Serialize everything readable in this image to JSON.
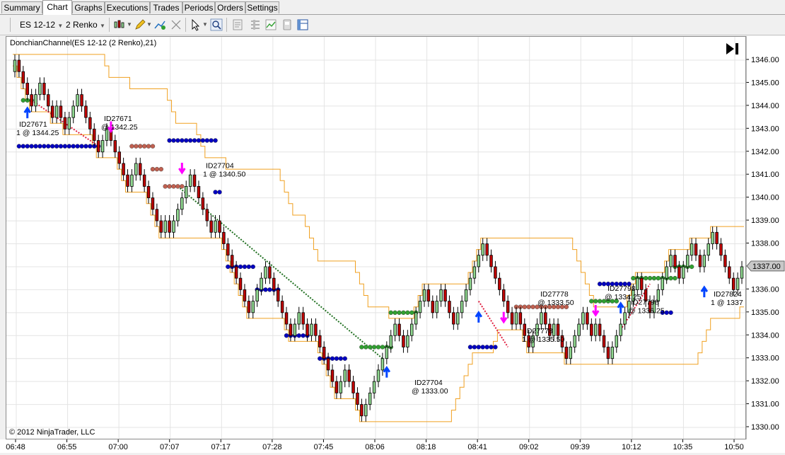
{
  "tabs": [
    {
      "label": "Summary",
      "active": false
    },
    {
      "label": "Chart",
      "active": true
    },
    {
      "label": "Graphs",
      "active": false
    },
    {
      "label": "Executions",
      "active": false
    },
    {
      "label": "Trades",
      "active": false
    },
    {
      "label": "Periods",
      "active": false
    },
    {
      "label": "Orders",
      "active": false
    },
    {
      "label": "Settings",
      "active": false
    }
  ],
  "toolbar": {
    "instrument": "ES 12-12",
    "bar_type": "2 Renko",
    "icons": [
      "bar-style-icon",
      "drawing-pencil-icon",
      "add-indicator-icon",
      "cursor-icon",
      "zoom-icon",
      "properties-icon",
      "data-box-icon",
      "strategy-icon",
      "chart-template-icon",
      "window-split-icon"
    ]
  },
  "chart": {
    "indicator_label": "DonchianChannel(ES 12-12 (2 Renko),21)",
    "copyright": "© 2012 NinjaTrader, LLC",
    "current_price_label": "1337.00",
    "colors": {
      "up": "#90d890",
      "down": "#c00000",
      "donchian": "#f0a020",
      "upper": "#0000c0",
      "lower": "#30a030",
      "mid_down": "#c06050",
      "buy": "#0044ff",
      "sell": "#ff00ff"
    },
    "annotations": [
      {
        "id": "ID27671",
        "fill": "1 @ 1344.25"
      },
      {
        "id": "ID27671",
        "fill": "@ 1342.25"
      },
      {
        "id": "ID27704",
        "fill": "1 @ 1340.50"
      },
      {
        "id": "ID27704",
        "fill": "@ 1333.00"
      },
      {
        "id": "ID27778",
        "fill": "1 @ 1335.50"
      },
      {
        "id": "ID27778",
        "fill": "@ 1333.50"
      },
      {
        "id": "ID27798",
        "fill": "@ 1334.25"
      },
      {
        "id": "ID27798",
        "fill": "@ 1336.25"
      },
      {
        "id": "ID27824",
        "fill": "1 @ 1337"
      }
    ]
  },
  "chart_data": {
    "type": "candlestick",
    "instrument": "ES 12-12",
    "bar_type": "2 Renko",
    "y_ticks": [
      "1346.00",
      "1345.00",
      "1344.00",
      "1343.00",
      "1342.00",
      "1341.00",
      "1340.00",
      "1339.00",
      "1338.00",
      "1337.00",
      "1336.00",
      "1335.00",
      "1334.00",
      "1333.00",
      "1332.00",
      "1331.00",
      "1330.00"
    ],
    "x_ticks": [
      "06:48",
      "06:55",
      "07:00",
      "07:07",
      "07:17",
      "07:28",
      "07:45",
      "08:06",
      "08:18",
      "08:41",
      "09:02",
      "09:39",
      "10:12",
      "10:35",
      "10:50"
    ],
    "ylim": [
      1329.7,
      1346.5
    ],
    "close": [
      1346.0,
      1345.5,
      1345.0,
      1344.5,
      1344.0,
      1344.5,
      1345.0,
      1344.5,
      1344.0,
      1343.5,
      1344.0,
      1343.5,
      1343.0,
      1343.5,
      1344.0,
      1344.5,
      1344.0,
      1343.5,
      1343.0,
      1342.5,
      1342.0,
      1342.5,
      1343.0,
      1342.5,
      1342.0,
      1341.5,
      1341.0,
      1340.5,
      1341.0,
      1341.5,
      1341.0,
      1340.5,
      1340.0,
      1339.5,
      1339.0,
      1338.5,
      1339.0,
      1338.5,
      1339.0,
      1339.5,
      1340.0,
      1340.5,
      1341.0,
      1340.5,
      1340.0,
      1339.5,
      1339.0,
      1338.5,
      1339.0,
      1338.5,
      1338.0,
      1337.5,
      1337.0,
      1336.5,
      1336.0,
      1335.5,
      1335.0,
      1335.5,
      1336.0,
      1336.5,
      1337.0,
      1336.5,
      1336.0,
      1335.5,
      1335.0,
      1334.5,
      1334.0,
      1334.5,
      1335.0,
      1334.5,
      1334.0,
      1334.5,
      1334.0,
      1333.5,
      1333.0,
      1332.5,
      1332.0,
      1331.5,
      1332.0,
      1332.5,
      1332.0,
      1331.5,
      1331.0,
      1330.5,
      1331.0,
      1331.5,
      1332.0,
      1332.5,
      1333.0,
      1333.5,
      1334.0,
      1334.5,
      1334.0,
      1333.5,
      1334.0,
      1334.5,
      1335.0,
      1335.5,
      1336.0,
      1335.5,
      1335.0,
      1335.5,
      1336.0,
      1335.5,
      1335.0,
      1334.5,
      1335.0,
      1335.5,
      1336.0,
      1336.5,
      1337.0,
      1337.5,
      1338.0,
      1337.5,
      1337.0,
      1336.5,
      1336.0,
      1335.5,
      1335.0,
      1334.5,
      1335.0,
      1334.5,
      1334.0,
      1333.5,
      1334.0,
      1334.5,
      1335.0,
      1334.5,
      1334.0,
      1334.5,
      1334.0,
      1333.5,
      1333.0,
      1333.5,
      1334.0,
      1334.5,
      1335.0,
      1334.5,
      1334.0,
      1334.5,
      1334.0,
      1333.5,
      1333.0,
      1333.5,
      1334.0,
      1334.5,
      1335.0,
      1335.5,
      1336.0,
      1336.5,
      1336.0,
      1335.5,
      1335.0,
      1335.5,
      1336.0,
      1336.5,
      1337.0,
      1337.5,
      1337.0,
      1336.5,
      1337.0,
      1337.5,
      1338.0,
      1337.5,
      1337.0,
      1337.5,
      1338.0,
      1338.5,
      1338.0,
      1337.5,
      1337.0,
      1336.5,
      1336.0,
      1336.5,
      1337.0
    ]
  }
}
